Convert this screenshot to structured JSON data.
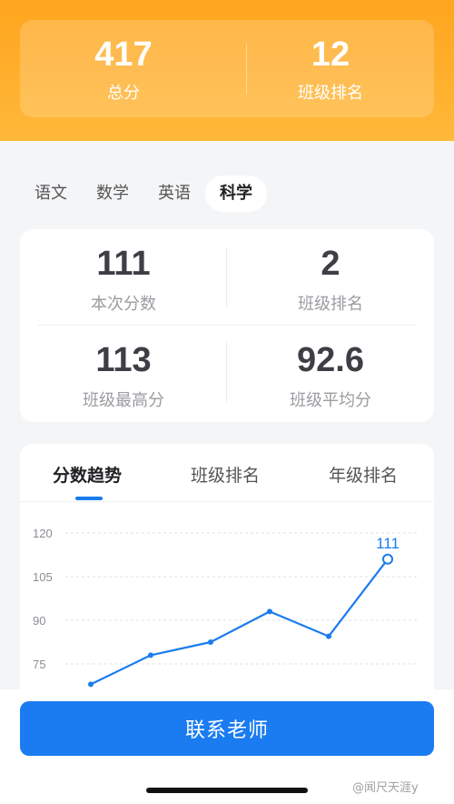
{
  "summary": {
    "total_score": "417",
    "total_label": "总分",
    "class_rank": "12",
    "class_rank_label": "班级排名"
  },
  "subject_tabs": [
    "语文",
    "数学",
    "英语",
    "科学"
  ],
  "active_subject": "科学",
  "stats": {
    "current_score": "111",
    "current_score_label": "本次分数",
    "class_rank": "2",
    "class_rank_label": "班级排名",
    "class_max": "113",
    "class_max_label": "班级最高分",
    "class_avg": "92.6",
    "class_avg_label": "班级平均分"
  },
  "trend_tabs": [
    "分数趋势",
    "班级排名",
    "年级排名"
  ],
  "chart_data": {
    "type": "line",
    "y_ticks": [
      120,
      105,
      90,
      75
    ],
    "ylim": [
      68,
      120
    ],
    "series": [
      {
        "values": [
          68,
          78,
          82.5,
          93,
          84.5,
          111
        ]
      }
    ],
    "highlight_label": "111",
    "grid": true
  },
  "buttons": {
    "contact_teacher": "联系老师"
  },
  "watermark": "@闻尺天涯y",
  "colors": {
    "accent": "#1a7cf0",
    "header": "#ffa51e"
  }
}
